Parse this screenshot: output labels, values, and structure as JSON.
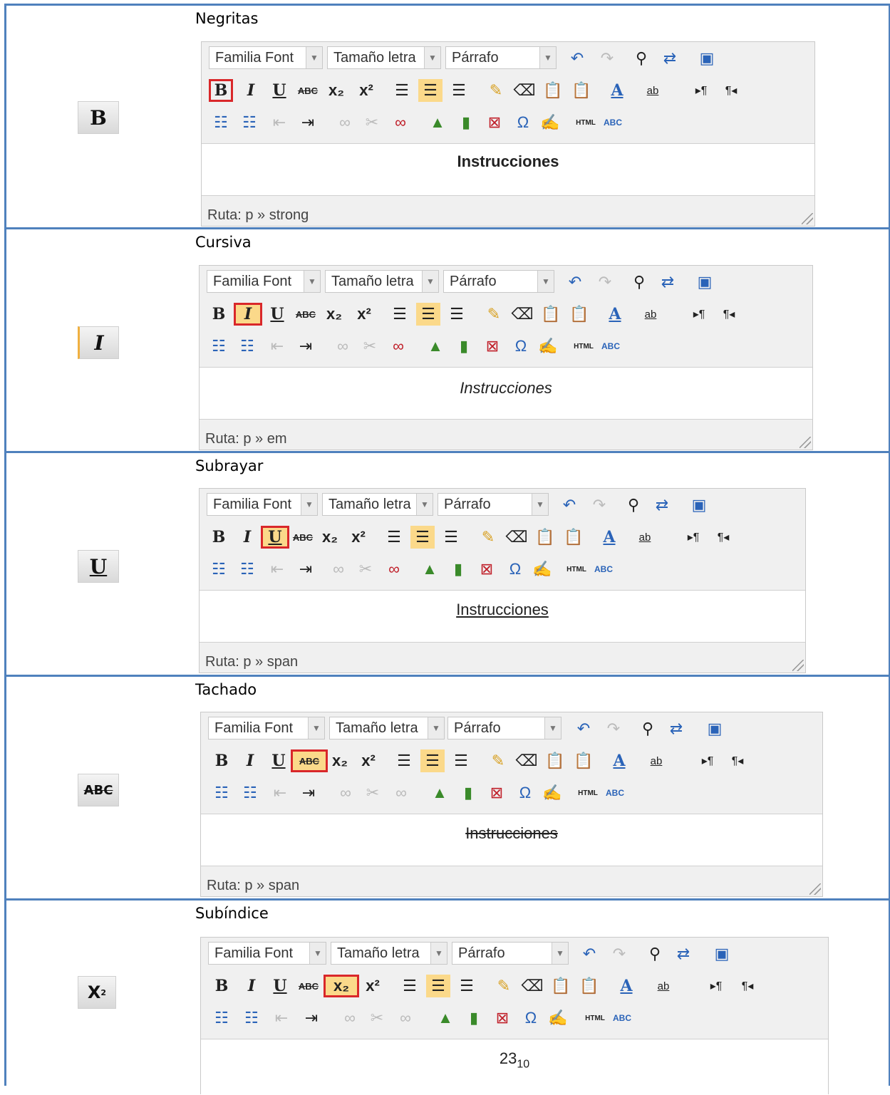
{
  "toolbar": {
    "font_family": "Familia Font",
    "font_size": "Tamaño letra",
    "paragraph": "Párrafo",
    "bold_glyph": "B",
    "italic_glyph": "I",
    "underline_glyph": "U",
    "strike_glyph": "ABC",
    "subscript_glyph": "x₂",
    "superscript_glyph": "x²",
    "html_label": "HTML",
    "spell_label": "ABC",
    "omega_glyph": "Ω",
    "font_color_glyph": "A",
    "highlight_glyph": "ab"
  },
  "sections": [
    {
      "title": "Negritas",
      "icon": "B",
      "content": "Instrucciones",
      "path": "Ruta: p » strong",
      "active": "bold"
    },
    {
      "title": "Cursiva",
      "icon": "I",
      "content": "Instrucciones",
      "path": "Ruta: p » em",
      "active": "italic"
    },
    {
      "title": "Subrayar",
      "icon": "U",
      "content": "Instrucciones",
      "path": "Ruta: p » span",
      "active": "underline"
    },
    {
      "title": "Tachado",
      "icon": "ABC",
      "content": "Instrucciones",
      "path": "Ruta: p » span",
      "active": "strike"
    },
    {
      "title": "Subíndice",
      "icon": "X",
      "icon_sub": "2",
      "content": "23",
      "content_sub": "10",
      "active": "subscript"
    }
  ]
}
